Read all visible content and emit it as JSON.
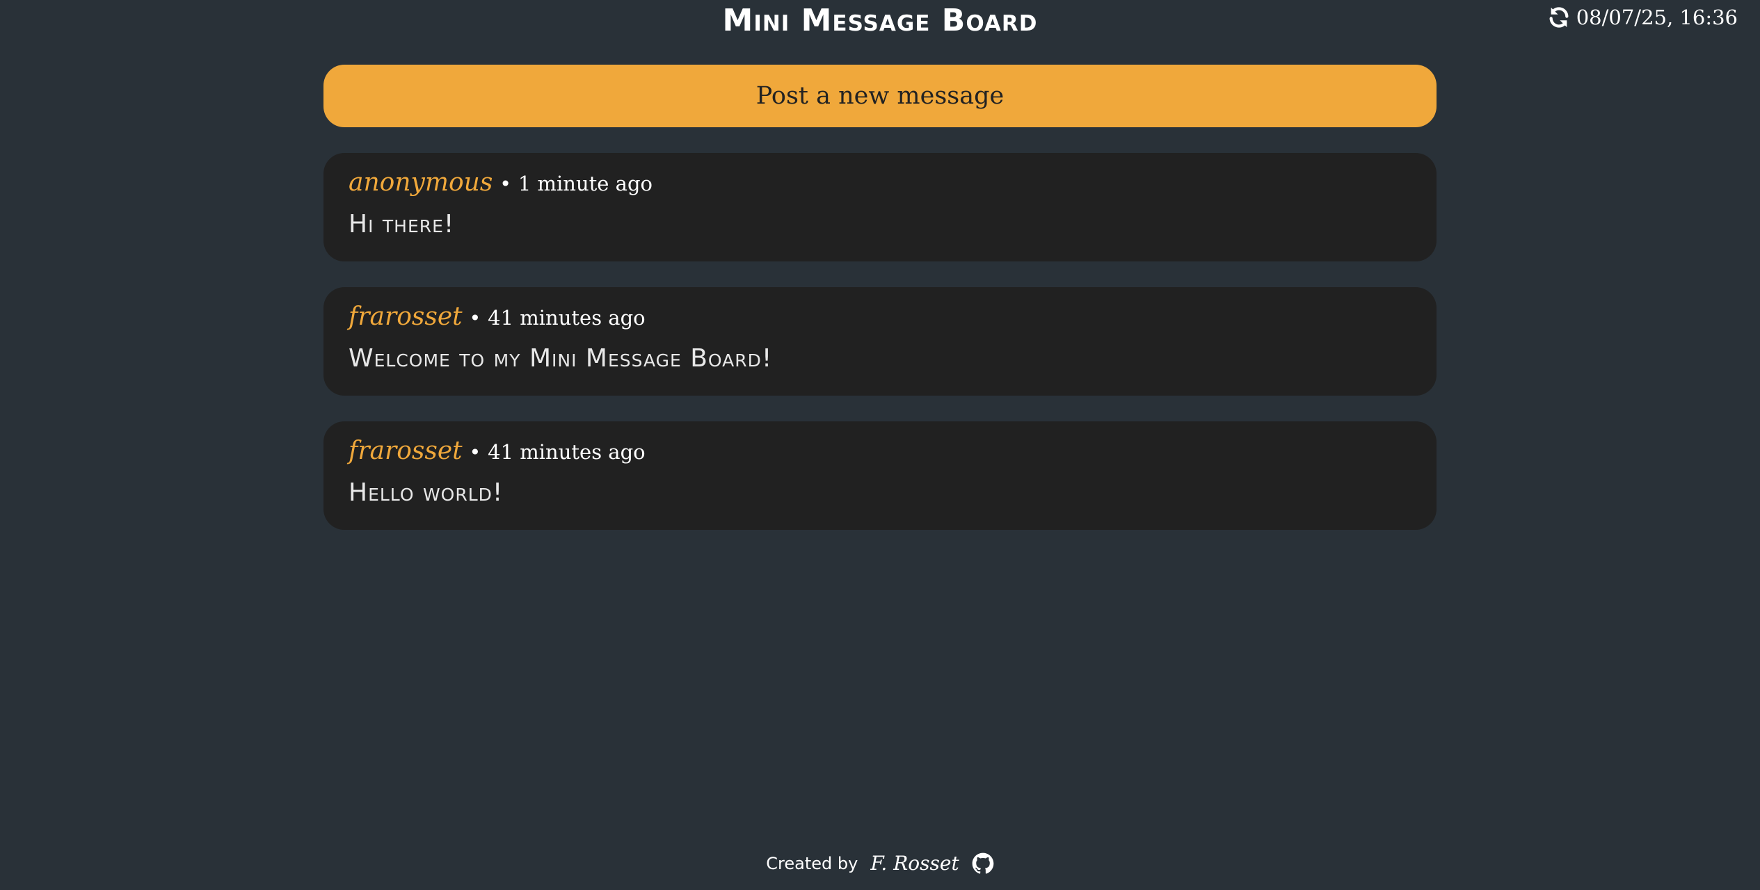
{
  "header": {
    "title": "Mini Message Board",
    "datetime": "08/07/25, 16:36",
    "refresh_icon": "refresh-icon"
  },
  "actions": {
    "post_label": "Post a new message"
  },
  "messages": [
    {
      "author": "anonymous",
      "separator": "•",
      "time": "1 minute ago",
      "text": "Hi there!"
    },
    {
      "author": "frarosset",
      "separator": "•",
      "time": "41 minutes ago",
      "text": "Welcome to my Mini Message Board!"
    },
    {
      "author": "frarosset",
      "separator": "•",
      "time": "41 minutes ago",
      "text": "Hello world!"
    }
  ],
  "footer": {
    "created_by": "Created by",
    "author": "F. Rosset",
    "icon": "github-icon"
  },
  "colors": {
    "background": "#293138",
    "accent": "#f0a83b",
    "card": "#212121"
  }
}
